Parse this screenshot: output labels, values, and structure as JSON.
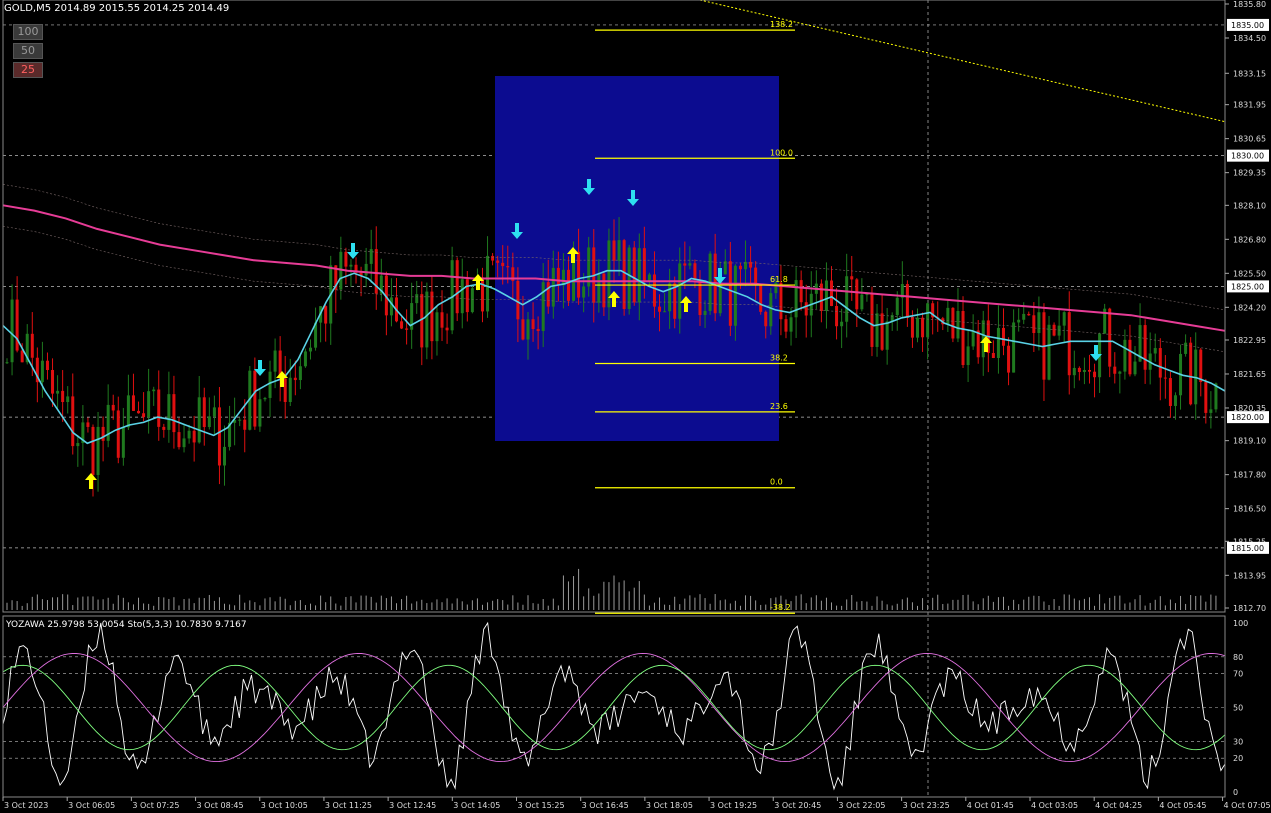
{
  "header": {
    "symbol_line": "GOLD,M5  2014.89 2015.55 2014.25 2014.49",
    "buttons": [
      "100",
      "50",
      "25"
    ]
  },
  "oscillator_label": "YOZAWA 25.9798 53.0054  Sto(5,3,3) 10.7830 9.7167",
  "colors": {
    "background": "#000000",
    "bull": "#1f7a1f",
    "bear": "#e01010",
    "ma_fast": "#5ad2e6",
    "ma_slow": "#e63c96",
    "fib": "#ffff00",
    "box": "#0c0c90",
    "arrow_up": "#ffff00",
    "arrow_down": "#2ee0f0",
    "volume": "#9a9a9a",
    "stoch_main": "#ffffff",
    "stoch_signal": "#e070e0",
    "yozawa": "#80ff80"
  },
  "chart_data": [
    {
      "type": "candlestick",
      "y_axis_ticks": [
        "1835.80",
        "1834.50",
        "1833.15",
        "1831.95",
        "1830.65",
        "1829.35",
        "1828.10",
        "1826.80",
        "1825.50",
        "1824.20",
        "1822.95",
        "1821.65",
        "1820.35",
        "1819.10",
        "1817.80",
        "1816.50",
        "1815.25",
        "1813.95",
        "1812.70"
      ],
      "ylim": [
        1812.7,
        1835.8
      ],
      "price_levels": [
        "1835.00",
        "1830.00",
        "1825.00",
        "1820.00",
        "1815.00"
      ],
      "x_axis_labels": [
        "3 Oct 2023",
        "3 Oct 06:05",
        "3 Oct 07:25",
        "3 Oct 08:45",
        "3 Oct 10:05",
        "3 Oct 11:25",
        "3 Oct 12:45",
        "3 Oct 14:05",
        "3 Oct 15:25",
        "3 Oct 16:45",
        "3 Oct 18:05",
        "3 Oct 19:25",
        "3 Oct 20:45",
        "3 Oct 22:05",
        "3 Oct 23:25",
        "4 Oct 01:45",
        "4 Oct 03:05",
        "4 Oct 04:25",
        "4 Oct 05:45",
        "4 Oct 07:05"
      ],
      "fibonacci": {
        "levels": [
          "138.2",
          "100.0",
          "61.8",
          "38.2",
          "23.6",
          "0.0",
          "-38.2"
        ],
        "prices": [
          1834.8,
          1829.9,
          1825.05,
          1822.05,
          1820.2,
          1817.3,
          1812.5
        ]
      },
      "ma_fast_path": [
        1823.5,
        1823.0,
        1822.0,
        1821.0,
        1820.2,
        1819.4,
        1819.0,
        1819.2,
        1819.5,
        1819.7,
        1819.8,
        1820.0,
        1819.9,
        1819.7,
        1819.5,
        1819.3,
        1819.6,
        1820.3,
        1821.0,
        1821.3,
        1821.5,
        1822.2,
        1823.3,
        1824.4,
        1825.3,
        1825.5,
        1825.3,
        1824.8,
        1824.1,
        1823.5,
        1823.8,
        1824.3,
        1824.6,
        1825.0,
        1825.1,
        1824.9,
        1824.6,
        1824.3,
        1824.6,
        1825.0,
        1825.1,
        1825.3,
        1825.4,
        1825.6,
        1825.6,
        1825.3,
        1825.0,
        1824.8,
        1825.0,
        1825.3,
        1825.2,
        1825.0,
        1824.8,
        1824.6,
        1824.3,
        1824.1,
        1824.0,
        1824.2,
        1824.4,
        1824.6,
        1824.2,
        1823.8,
        1823.5,
        1823.6,
        1823.8,
        1823.9,
        1824.0,
        1823.6,
        1823.4,
        1823.3,
        1823.1,
        1823.0,
        1822.9,
        1822.8,
        1822.7,
        1822.8,
        1822.9,
        1822.9,
        1822.9,
        1822.9,
        1822.6,
        1822.3,
        1822.0,
        1821.8,
        1821.6,
        1821.5,
        1821.3,
        1821.0
      ],
      "ma_slow_path": [
        1828.1,
        1827.9,
        1827.6,
        1827.2,
        1826.9,
        1826.6,
        1826.4,
        1826.2,
        1826.0,
        1825.9,
        1825.8,
        1825.6,
        1825.5,
        1825.4,
        1825.4,
        1825.3,
        1825.3,
        1825.3,
        1825.2,
        1825.2,
        1825.2,
        1825.2,
        1825.2,
        1825.1,
        1825.1,
        1825.0,
        1824.9,
        1824.8,
        1824.7,
        1824.6,
        1824.5,
        1824.4,
        1824.3,
        1824.2,
        1824.1,
        1824.0,
        1823.9,
        1823.7,
        1823.5,
        1823.3
      ],
      "volume_note": "histogram on bottom of price panel"
    },
    {
      "type": "line",
      "name_main": "Sto(5,3,3)",
      "yozawa_value": "25.9798",
      "stoch_values": [
        "53.0054",
        "10.7830",
        "9.7167"
      ],
      "ylim": [
        0,
        100
      ],
      "y_axis_ticks": [
        "100",
        "80",
        "70",
        "50",
        "30",
        "20",
        "0"
      ],
      "levels": [
        80,
        70,
        50,
        30,
        20
      ]
    }
  ]
}
